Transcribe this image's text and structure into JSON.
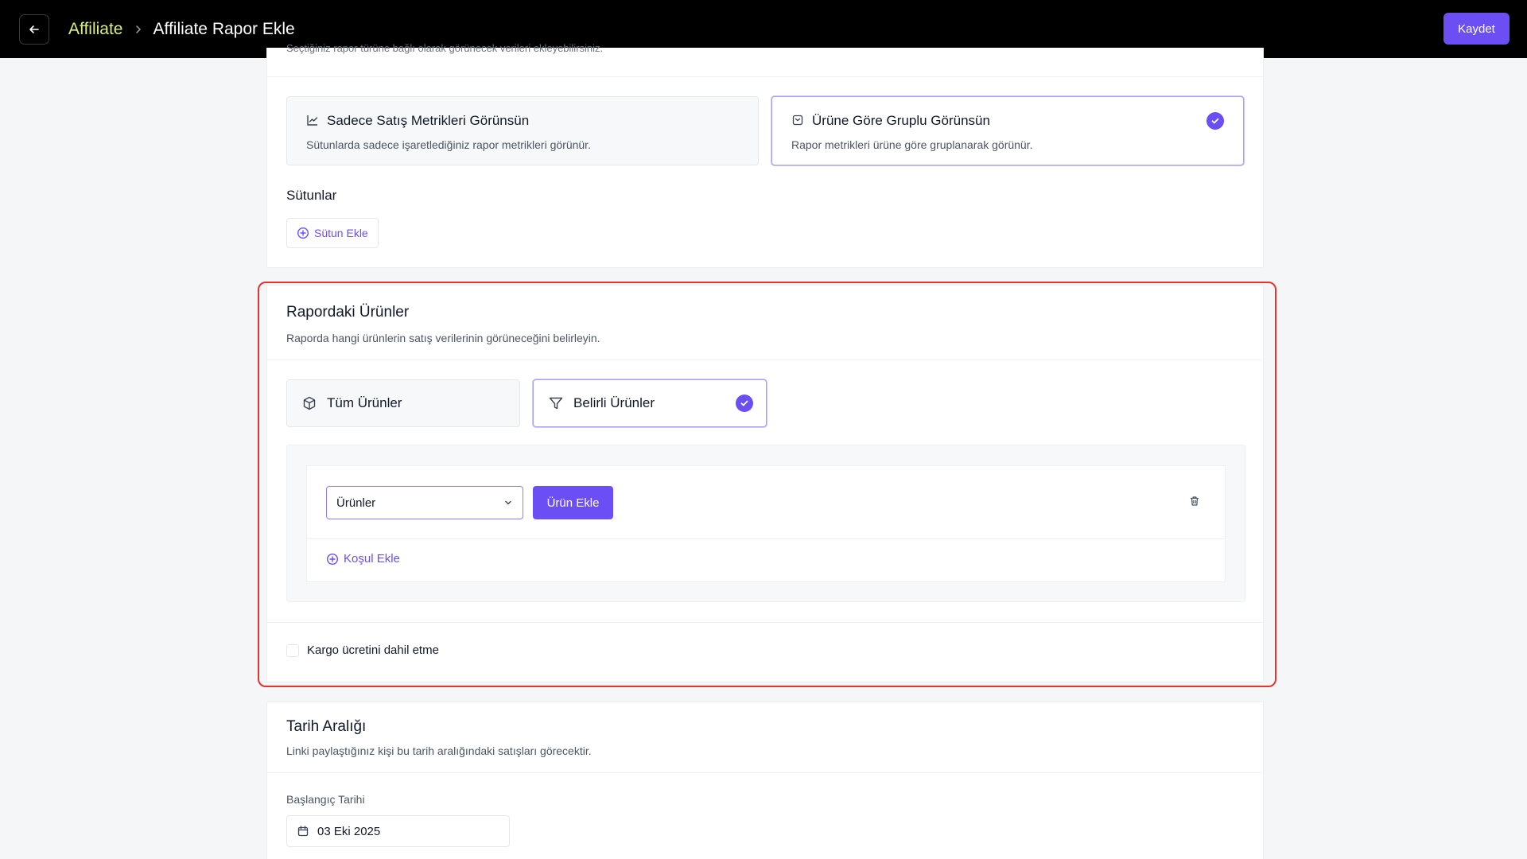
{
  "header": {
    "breadcrumb_parent": "Affiliate",
    "title": "Affiliate Rapor Ekle",
    "save_label": "Kaydet"
  },
  "display_section": {
    "cut_text": "Seçtiğiniz rapor türüne bağlı olarak görünecek verileri ekleyebilirsiniz.",
    "options": [
      {
        "title": "Sadece Satış Metrikleri Görünsün",
        "description": "Sütunlarda sadece işaretlediğiniz rapor metrikleri görünür.",
        "selected": false
      },
      {
        "title": "Ürüne Göre Gruplu Görünsün",
        "description": "Rapor metrikleri ürüne göre gruplanarak görünür.",
        "selected": true
      }
    ],
    "columns_label": "Sütunlar",
    "add_column_label": "Sütun Ekle"
  },
  "products_section": {
    "title": "Rapordaki Ürünler",
    "subtitle": "Raporda hangi ürünlerin satış verilerinin görüneceğini belirleyin.",
    "options": [
      {
        "label": "Tüm Ürünler",
        "selected": false
      },
      {
        "label": "Belirli Ürünler",
        "selected": true
      }
    ],
    "select_value": "Ürünler",
    "add_product_label": "Ürün Ekle",
    "add_condition_label": "Koşul Ekle",
    "exclude_shipping_label": "Kargo ücretini dahil etme",
    "exclude_shipping_checked": false
  },
  "date_section": {
    "title": "Tarih Aralığı",
    "subtitle": "Linki paylaştığınız kişi bu tarih aralığındaki satışları görecektir.",
    "start_label": "Başlangıç Tarihi",
    "start_value": "03 Eki 2025"
  },
  "colors": {
    "accent": "#6c4ef5",
    "breadcrumb_link": "#d9ef7b",
    "highlight": "#e8322c"
  }
}
